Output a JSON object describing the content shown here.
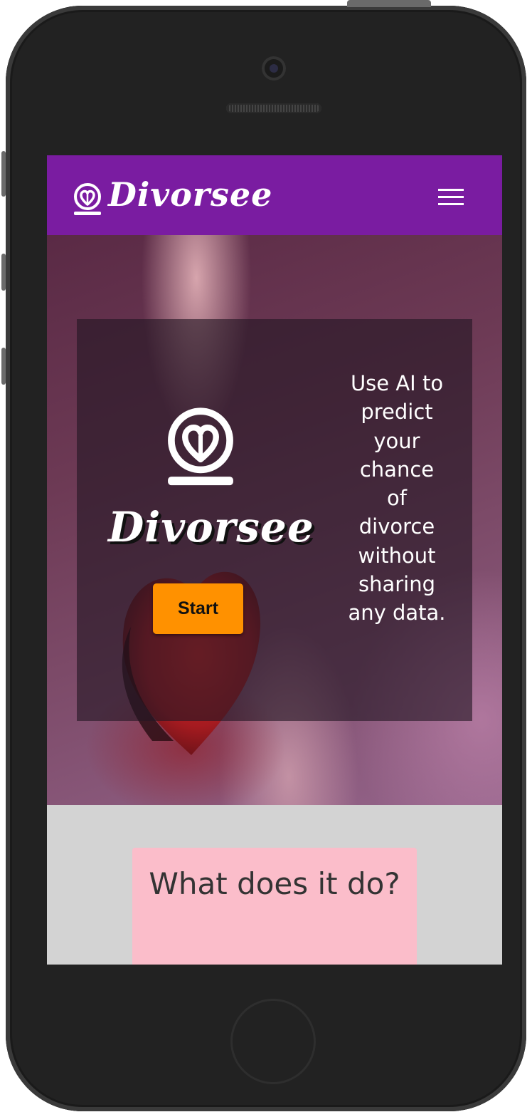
{
  "navbar": {
    "brand": "Divorsee",
    "logo_icon": "heart-ring-icon",
    "menu_icon": "hamburger-menu-icon"
  },
  "hero": {
    "brand": "Divorsee",
    "logo_icon": "heart-ring-icon",
    "start_label": "Start",
    "tagline": "Use AI to predict your chance of divorce without sharing any data."
  },
  "info": {
    "title": "What does it do?"
  },
  "colors": {
    "navbar": "#7a1ca1",
    "start_button": "#ff9100",
    "info_card": "#fbbdca",
    "page_bg": "#d3d3d3"
  }
}
